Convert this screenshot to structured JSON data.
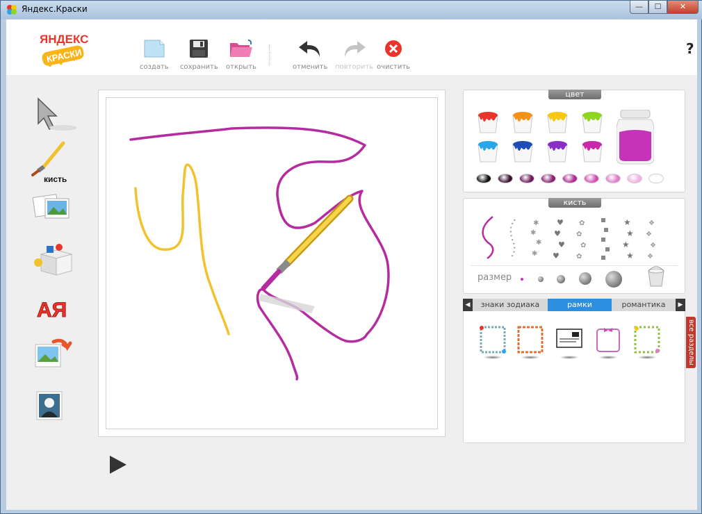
{
  "window": {
    "title": "Яндекс.Краски",
    "min_symbol": "—",
    "max_symbol": "☐",
    "close_symbol": "✕"
  },
  "logo": {
    "line1": "ЯНДЕКС",
    "line2": "КРАСКИ"
  },
  "toolbar": {
    "create_label": "создать",
    "save_label": "сохранить",
    "open_label": "открыть",
    "undo_label": "отменить",
    "redo_label": "повторить",
    "clear_label": "очистить",
    "help_label": "?"
  },
  "tools": {
    "brush_label": "кисть",
    "text_tool_label": "АЯ"
  },
  "color_panel": {
    "title": "цвет",
    "paints": [
      {
        "name": "red",
        "color": "#e8352b"
      },
      {
        "name": "orange",
        "color": "#f39217"
      },
      {
        "name": "yellow",
        "color": "#f5c814"
      },
      {
        "name": "lime",
        "color": "#8fd61e"
      },
      {
        "name": "light-blue",
        "color": "#2aa6e8"
      },
      {
        "name": "blue",
        "color": "#1d4db5"
      },
      {
        "name": "violet",
        "color": "#8b2fc4"
      },
      {
        "name": "magenta",
        "color": "#c929a9"
      }
    ],
    "current_color": "#c633b8",
    "shades": [
      "#111111",
      "#3a1030",
      "#6a1a5a",
      "#8a2070",
      "#b0288f",
      "#d04eaf",
      "#e07ac8",
      "#efb2df",
      "#ffffff"
    ]
  },
  "brush_panel": {
    "title": "кисть",
    "size_label": "размер"
  },
  "section_tabs": {
    "items": [
      "знаки зодиака",
      "рамки",
      "романтика"
    ],
    "active": "рамки",
    "all_sections": "все разделы"
  }
}
